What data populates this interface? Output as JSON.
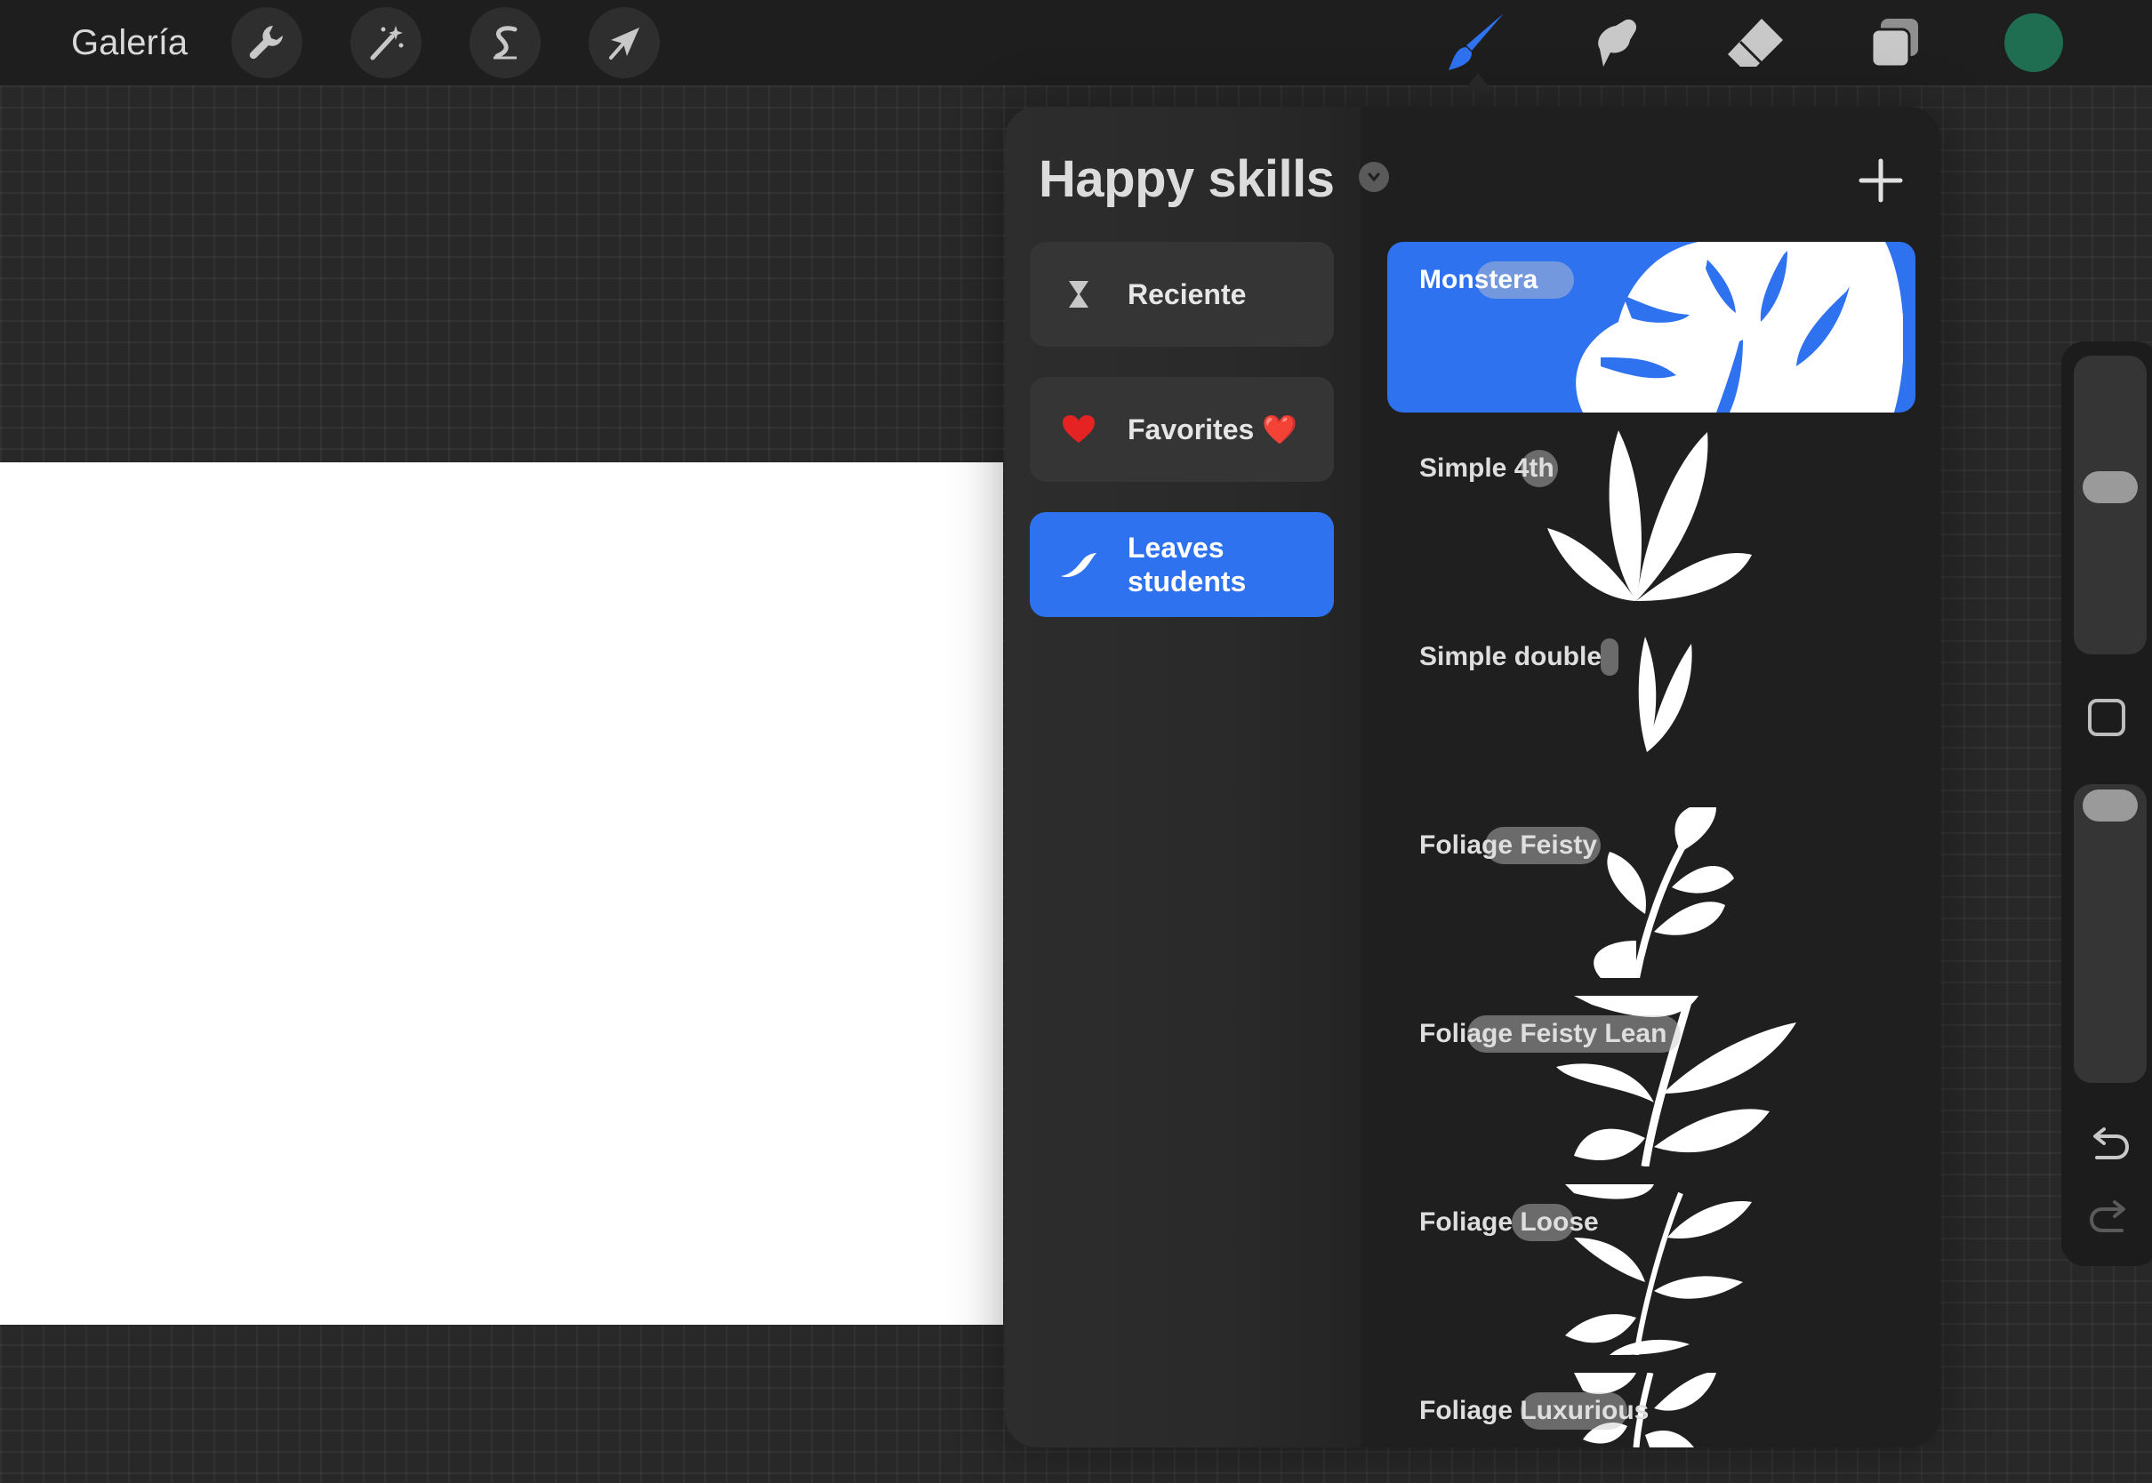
{
  "topbar": {
    "gallery_label": "Galería",
    "tools": [
      "wrench-icon",
      "magic-wand-icon",
      "selection-icon",
      "transform-arrow-icon"
    ],
    "right_tools": [
      "brush-icon",
      "smudge-icon",
      "eraser-icon",
      "layers-icon"
    ],
    "active_tool": "brush",
    "current_color": "#1f6e52"
  },
  "brush_library": {
    "title": "Happy skills",
    "sets": [
      {
        "label": "Reciente",
        "icon": "hourglass-icon",
        "active": false
      },
      {
        "label": "Favorites ❤️",
        "icon": "heart-icon",
        "active": false
      },
      {
        "label": "Leaves students",
        "icon": "stroke-icon",
        "active": true
      }
    ],
    "brushes": [
      {
        "name": "Monstera",
        "selected": true
      },
      {
        "name": "Simple 4th",
        "selected": false
      },
      {
        "name": "Simple double",
        "selected": false
      },
      {
        "name": "Foliage Feisty",
        "selected": false
      },
      {
        "name": "Foliage Feisty Lean",
        "selected": false
      },
      {
        "name": "Foliage Loose",
        "selected": false
      },
      {
        "name": "Foliage Luxurious",
        "selected": false
      }
    ]
  },
  "sidebar": {
    "size_slider_value": 0.55,
    "opacity_slider_value": 1.0
  },
  "colors": {
    "accent": "#2e72f0",
    "topbar": "#1e1e1e",
    "panel": "#1f1f1f"
  }
}
